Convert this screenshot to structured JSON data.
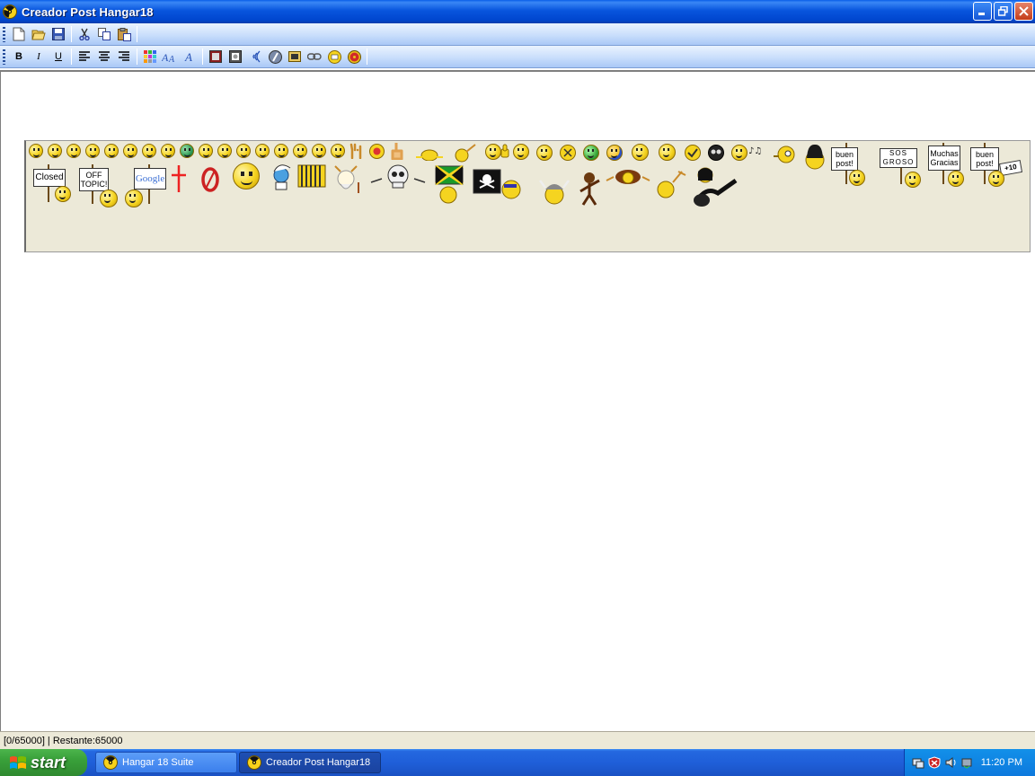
{
  "window": {
    "title": "Creador Post Hangar18"
  },
  "toolbar1": {
    "items": [
      "new-icon",
      "open-icon",
      "save-icon",
      "cut-icon",
      "copy-icon",
      "paste-icon"
    ]
  },
  "toolbar2": {
    "bold": "B",
    "italic": "I",
    "underline": "U"
  },
  "emoticons": {
    "signs": {
      "closed": "Closed",
      "offtopic": "OFF TOPIC!",
      "google": "Google",
      "buen_post": "buen post!",
      "sos_groso": "SOS GROSO",
      "muchas_gracias": "Muchas Gracias",
      "buen_post_10": "buen post!",
      "plus10": "+10"
    }
  },
  "status": {
    "text": "[0/65000] | Restante:65000"
  },
  "taskbar": {
    "start": "start",
    "tasks": [
      {
        "label": "Hangar 18 Suite"
      },
      {
        "label": "Creador Post Hangar18"
      }
    ],
    "clock": "11:20 PM"
  }
}
